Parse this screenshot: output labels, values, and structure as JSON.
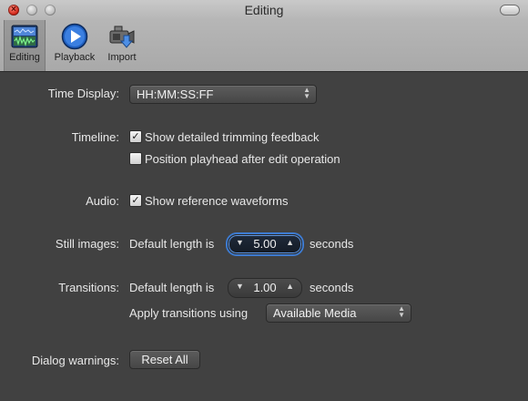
{
  "window": {
    "title": "Editing"
  },
  "toolbar": {
    "tabs": [
      {
        "label": "Editing",
        "icon": "editing-waveform-icon",
        "selected": true
      },
      {
        "label": "Playback",
        "icon": "play-circle-icon",
        "selected": false
      },
      {
        "label": "Import",
        "icon": "camera-import-icon",
        "selected": false
      }
    ]
  },
  "settings": {
    "time_display": {
      "label": "Time Display:",
      "value": "HH:MM:SS:FF"
    },
    "timeline": {
      "label": "Timeline:",
      "options": [
        {
          "text": "Show detailed trimming feedback",
          "checked": true
        },
        {
          "text": "Position playhead after edit operation",
          "checked": false
        }
      ]
    },
    "audio": {
      "label": "Audio:",
      "option": {
        "text": "Show reference waveforms",
        "checked": true
      }
    },
    "still_images": {
      "label": "Still images:",
      "prefix": "Default length is",
      "value": "5.00",
      "suffix": "seconds"
    },
    "transitions": {
      "label": "Transitions:",
      "prefix": "Default length is",
      "value": "1.00",
      "suffix": "seconds",
      "apply_label": "Apply transitions using",
      "apply_value": "Available Media"
    },
    "dialog_warnings": {
      "label": "Dialog warnings:",
      "button": "Reset All"
    }
  },
  "colors": {
    "accent": "#3d7bd1",
    "background": "#414141",
    "checkmark": "#1a1a1a"
  }
}
